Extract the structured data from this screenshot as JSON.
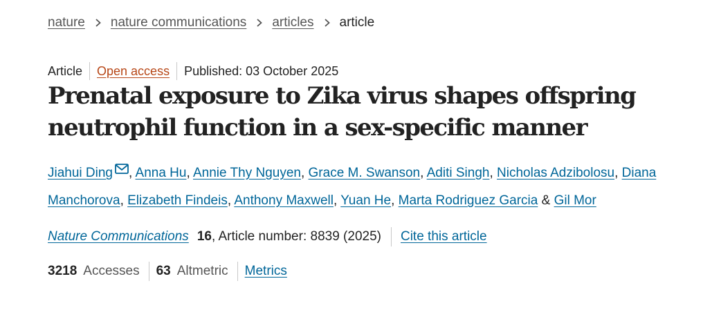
{
  "breadcrumb": {
    "items": [
      {
        "label": "nature"
      },
      {
        "label": "nature communications"
      },
      {
        "label": "articles"
      }
    ],
    "current": "article"
  },
  "meta": {
    "type": "Article",
    "access": "Open access",
    "published": "Published: 03 October 2025"
  },
  "title": "Prenatal exposure to Zika virus shapes offspring neutrophil function in a sex-specific manner",
  "authors": {
    "names": [
      "Jiahui Ding",
      "Anna Hu",
      "Annie Thy Nguyen",
      "Grace M. Swanson",
      "Aditi Singh",
      "Nicholas Adzibolosu",
      "Diana Manchorova",
      "Elizabeth Findeis",
      "Anthony Maxwell",
      "Yuan He",
      "Marta Rodriguez Garcia",
      "Gil Mor"
    ],
    "separator": ", ",
    "last_separator": " & ",
    "corresponding_icon": "mail-icon"
  },
  "citation": {
    "journal": "Nature Communications",
    "volume": "16",
    "rest": ", Article number: 8839 (2025)",
    "cite_link": "Cite this article"
  },
  "metrics": {
    "accesses_value": "3218",
    "accesses_label": "Accesses",
    "altmetric_value": "63",
    "altmetric_label": "Altmetric",
    "metrics_link": "Metrics"
  },
  "colors": {
    "link": "#006699",
    "open_access": "#b74616",
    "text": "#222222",
    "muted": "#555555"
  }
}
